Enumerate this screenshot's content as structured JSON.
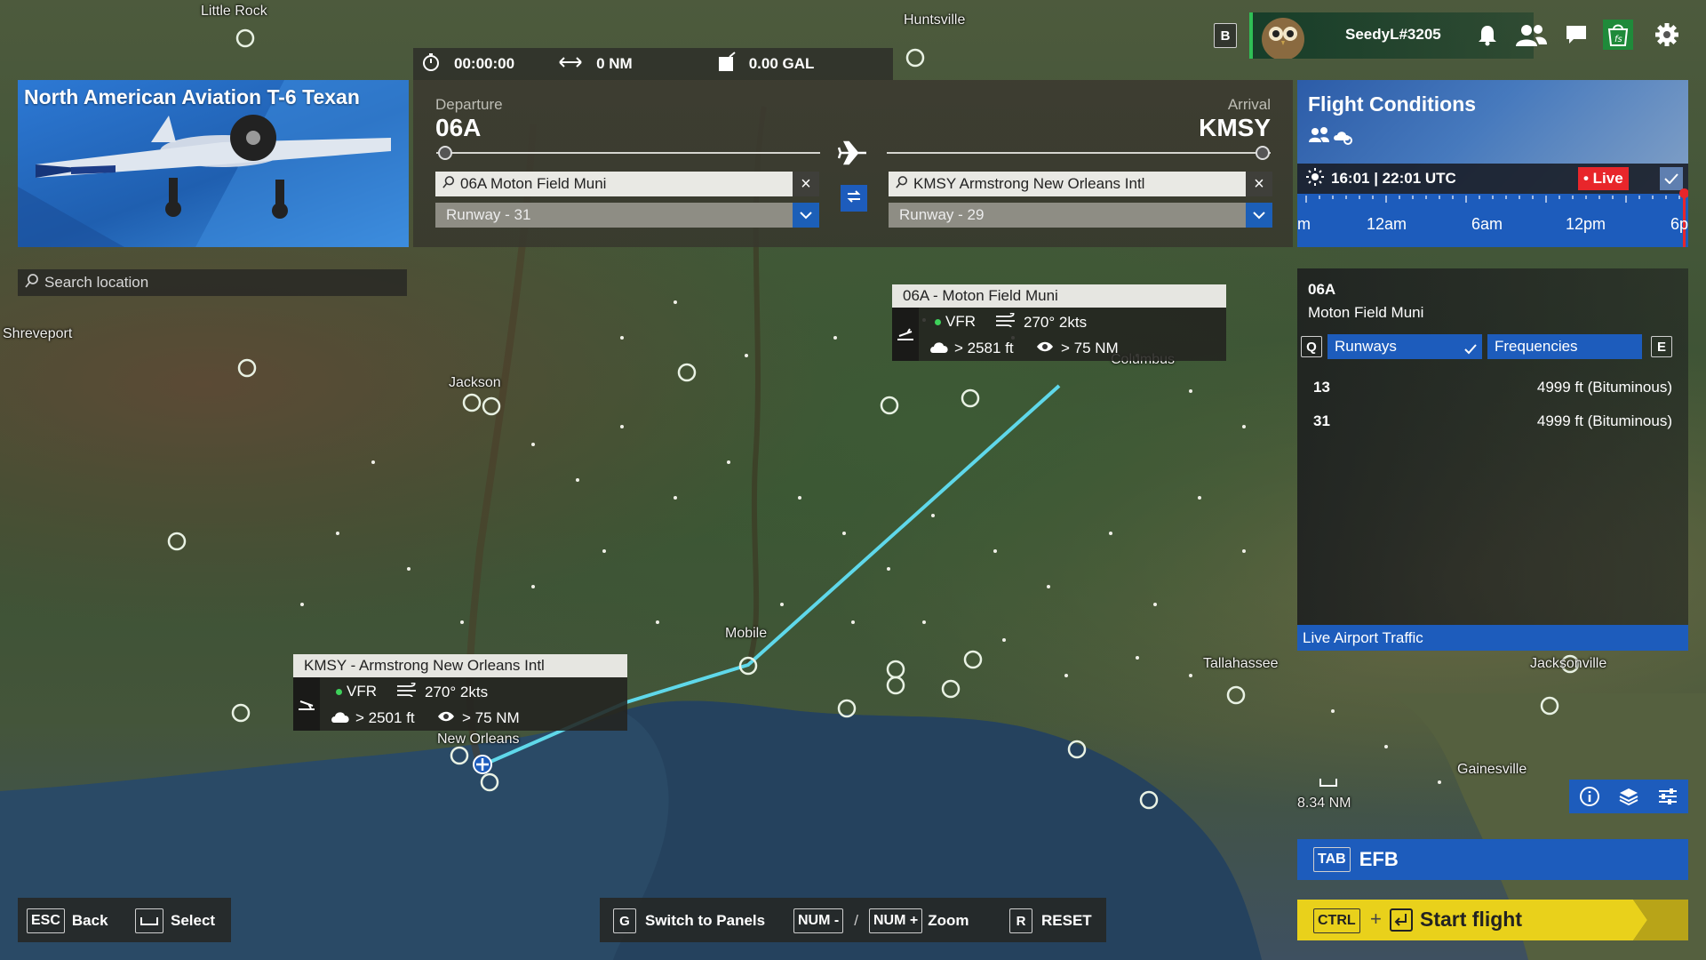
{
  "map": {
    "cities": {
      "little_rock": "Little Rock",
      "huntsville": "Huntsville",
      "shreveport": "Shreveport",
      "jackson": "Jackson",
      "columbus": "Columbus",
      "mobile": "Mobile",
      "tallahassee": "Tallahassee",
      "jacksonville": "Jacksonville",
      "new_orleans": "New Orleans",
      "gainesville": "Gainesville"
    },
    "scale_label": "8.34 NM",
    "route_color": "#5fd8ea"
  },
  "stats": {
    "time": "00:00:00",
    "distance": "0 NM",
    "fuel": "0.00 GAL"
  },
  "aircraft": {
    "name": "North American Aviation T-6 Texan"
  },
  "search": {
    "placeholder": "Search location"
  },
  "route": {
    "departure_label": "Departure",
    "departure_code": "06A",
    "departure_field": "06A Moton Field Muni",
    "departure_runway": "Runway - 31",
    "arrival_label": "Arrival",
    "arrival_code": "KMSY",
    "arrival_field": "KMSY Armstrong New Orleans Intl",
    "arrival_runway": "Runway - 29"
  },
  "user": {
    "key_hint": "B",
    "username": "SeedyL#3205"
  },
  "flight_conditions": {
    "title": "Flight Conditions",
    "time": "16:01 | 22:01 UTC",
    "live_label": "• Live",
    "scale_labels": [
      "m",
      "12am",
      "6am",
      "12pm",
      "6p"
    ]
  },
  "airport_panel": {
    "code": "06A",
    "name": "Moton Field Muni",
    "tab_prev_key": "Q",
    "tab_next_key": "E",
    "tabs": [
      "Runways",
      "Frequencies"
    ],
    "runways": [
      {
        "id": "13",
        "info": "4999 ft (Bituminous)"
      },
      {
        "id": "31",
        "info": "4999 ft (Bituminous)"
      }
    ],
    "traffic_label": "Live Airport Traffic"
  },
  "tooltips": {
    "dep": {
      "title": "06A - Moton Field Muni",
      "rules": "VFR",
      "wind": "270° 2kts",
      "ceiling": "> 2581 ft",
      "visibility": "> 75 NM"
    },
    "arr": {
      "title": "KMSY - Armstrong New Orleans Intl",
      "rules": "VFR",
      "wind": "270° 2kts",
      "ceiling": "> 2501 ft",
      "visibility": "> 75 NM"
    }
  },
  "efb": {
    "key": "TAB",
    "label": "EFB"
  },
  "start_flight": {
    "key": "CTRL",
    "plus": "+",
    "label": "Start flight"
  },
  "hints": {
    "back_key": "ESC",
    "back_label": "Back",
    "select_label": "Select",
    "panels_key": "G",
    "panels_label": "Switch to Panels",
    "zoom_out_key": "NUM -",
    "zoom_sep": "/",
    "zoom_in_key": "NUM +",
    "zoom_label": "Zoom",
    "reset_key": "R",
    "reset_label": "RESET"
  },
  "colors": {
    "accent_blue": "#1d5cbc",
    "live_red": "#e8262b",
    "start_yellow": "#e9d11b",
    "vfr_green": "#3ed15a"
  }
}
